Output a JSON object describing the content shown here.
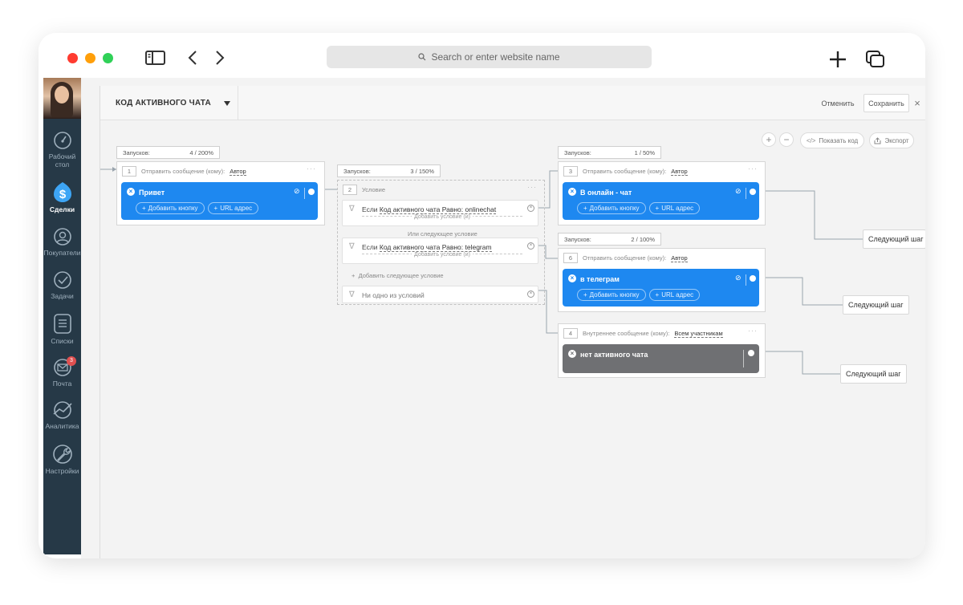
{
  "browser": {
    "address_placeholder": "Search or enter website name"
  },
  "sidebar": {
    "items": [
      {
        "label_line1": "Рабочий",
        "label_line2": "стол"
      },
      {
        "label": "Сделки"
      },
      {
        "label": "Покупатели"
      },
      {
        "label": "Задачи"
      },
      {
        "label": "Списки"
      },
      {
        "label": "Почта",
        "badge": "3"
      },
      {
        "label": "Аналитика"
      },
      {
        "label": "Настройки"
      }
    ]
  },
  "topbar": {
    "title": "КОД АКТИВНОГО ЧАТА",
    "cancel": "Отменить",
    "save": "Сохранить",
    "close": "×"
  },
  "tools": {
    "zoom_in": "+",
    "zoom_out": "−",
    "show_code": "Показать код",
    "export": "Экспорт"
  },
  "flow": {
    "launches_label": "Запусков:",
    "step1": {
      "launches": "4 / 200%",
      "num": "1",
      "action": "Отправить сообщение (кому):",
      "target": "Автор",
      "message": "Привет",
      "add_button": "Добавить кнопку",
      "url": "URL адрес"
    },
    "step2": {
      "launches": "3 / 150%",
      "num": "2",
      "action": "Условие",
      "cond1_prefix": "Если",
      "cond1_link": "Код активного чата Равно: onlinechat",
      "cond_add_and": "Добавить условие (и)",
      "or_label": "Или следующее условие",
      "cond2_prefix": "Если",
      "cond2_link": "Код активного чата Равно: telegram",
      "add_next": "Добавить следующее условие",
      "none": "Ни одно из условий"
    },
    "step3": {
      "launches": "1 / 50%",
      "num": "3",
      "action": "Отправить сообщение (кому):",
      "target": "Автор",
      "message": "В онлайн - чат",
      "add_button": "Добавить кнопку",
      "url": "URL адрес"
    },
    "step6": {
      "launches": "2 / 100%",
      "num": "6",
      "action": "Отправить сообщение (кому):",
      "target": "Автор",
      "message": "в телеграм",
      "add_button": "Добавить кнопку",
      "url": "URL адрес"
    },
    "step4": {
      "num": "4",
      "action": "Внутреннее сообщение (кому):",
      "target": "Всем участникам",
      "message": "нет активного чата"
    },
    "next_step": "Следующий шаг"
  },
  "colors": {
    "sidebar_bg": "#263947",
    "message_blue": "#1e88f0",
    "message_gray": "#6f7073",
    "canvas_bg": "#f3f3f3"
  }
}
